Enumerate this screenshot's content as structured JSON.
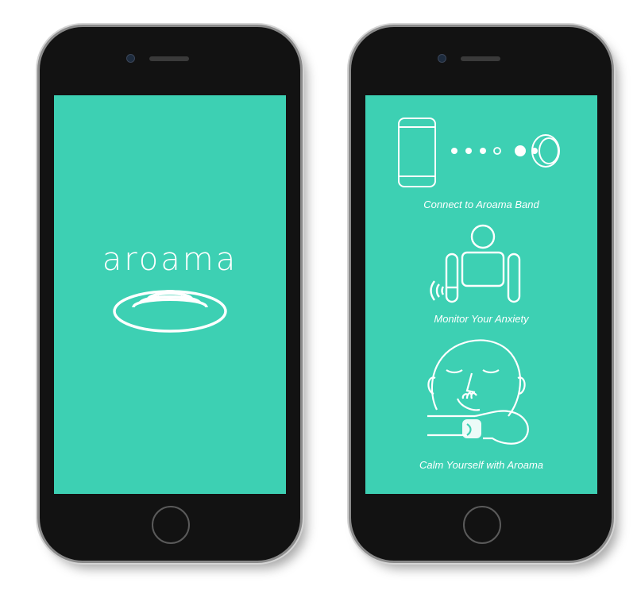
{
  "screens": {
    "splash": {
      "app_name": "aroama",
      "logo_icon": "aroama-ripple-logo"
    },
    "onboarding": {
      "steps": [
        {
          "label": "Connect to Aroama Band",
          "icon": "phone-to-band-icon"
        },
        {
          "label": "Monitor Your Anxiety",
          "icon": "person-wrist-vibration-icon"
        },
        {
          "label": "Calm Yourself with Aroama",
          "icon": "face-inhaling-band-icon"
        }
      ]
    }
  },
  "colors": {
    "screen_background": "#3dd0b3",
    "phone_body": "#121212",
    "foreground": "#ffffff"
  }
}
